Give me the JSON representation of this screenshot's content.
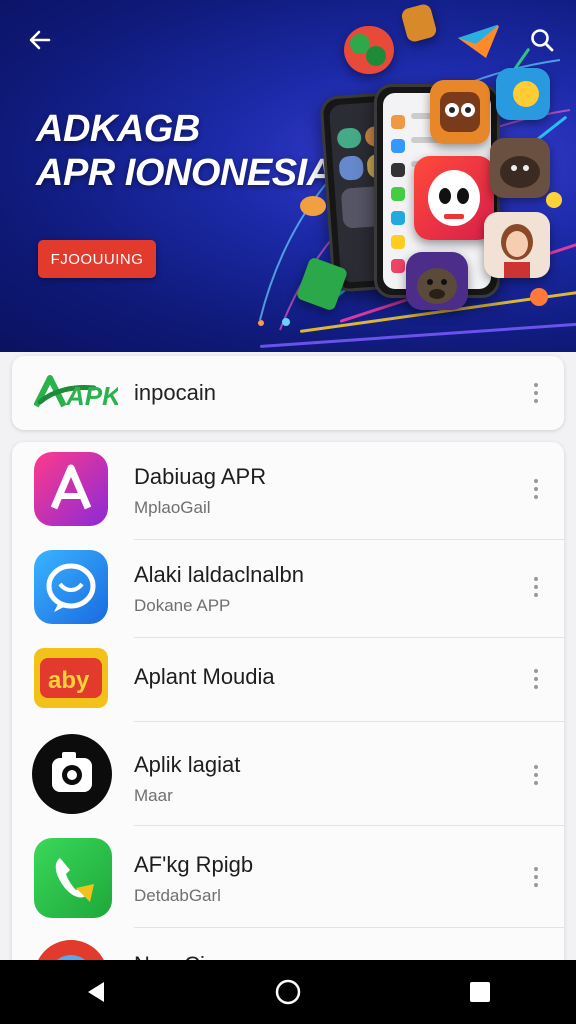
{
  "banner": {
    "title_line1": "ADKAGB",
    "title_line2": "APR IONONESIA",
    "cta_label": "FJOOUUING"
  },
  "header": {
    "logo_text": "APK",
    "title": "inpocain"
  },
  "apps": [
    {
      "name": "Dabiuag APR",
      "subtitle": "MplaoGail",
      "icon": "letter-a-icon"
    },
    {
      "name": "Alaki laldaclnalbn",
      "subtitle": "Dokane APP",
      "icon": "chat-shield-icon"
    },
    {
      "name": "Aplant Moudia",
      "subtitle": "",
      "icon": "aby-logo-icon"
    },
    {
      "name": "Aplik lagiat",
      "subtitle": "Maar",
      "icon": "camera-icon"
    },
    {
      "name": "AF'kg Rpigb",
      "subtitle": "DetdabGarl",
      "icon": "phone-icon"
    },
    {
      "name": "New Cieon",
      "subtitle": "",
      "icon": "red-circle-icon"
    }
  ],
  "colors": {
    "banner_bg": "#1c2aa8",
    "cta": "#e23a2c",
    "apk_green": "#2bb24c"
  }
}
